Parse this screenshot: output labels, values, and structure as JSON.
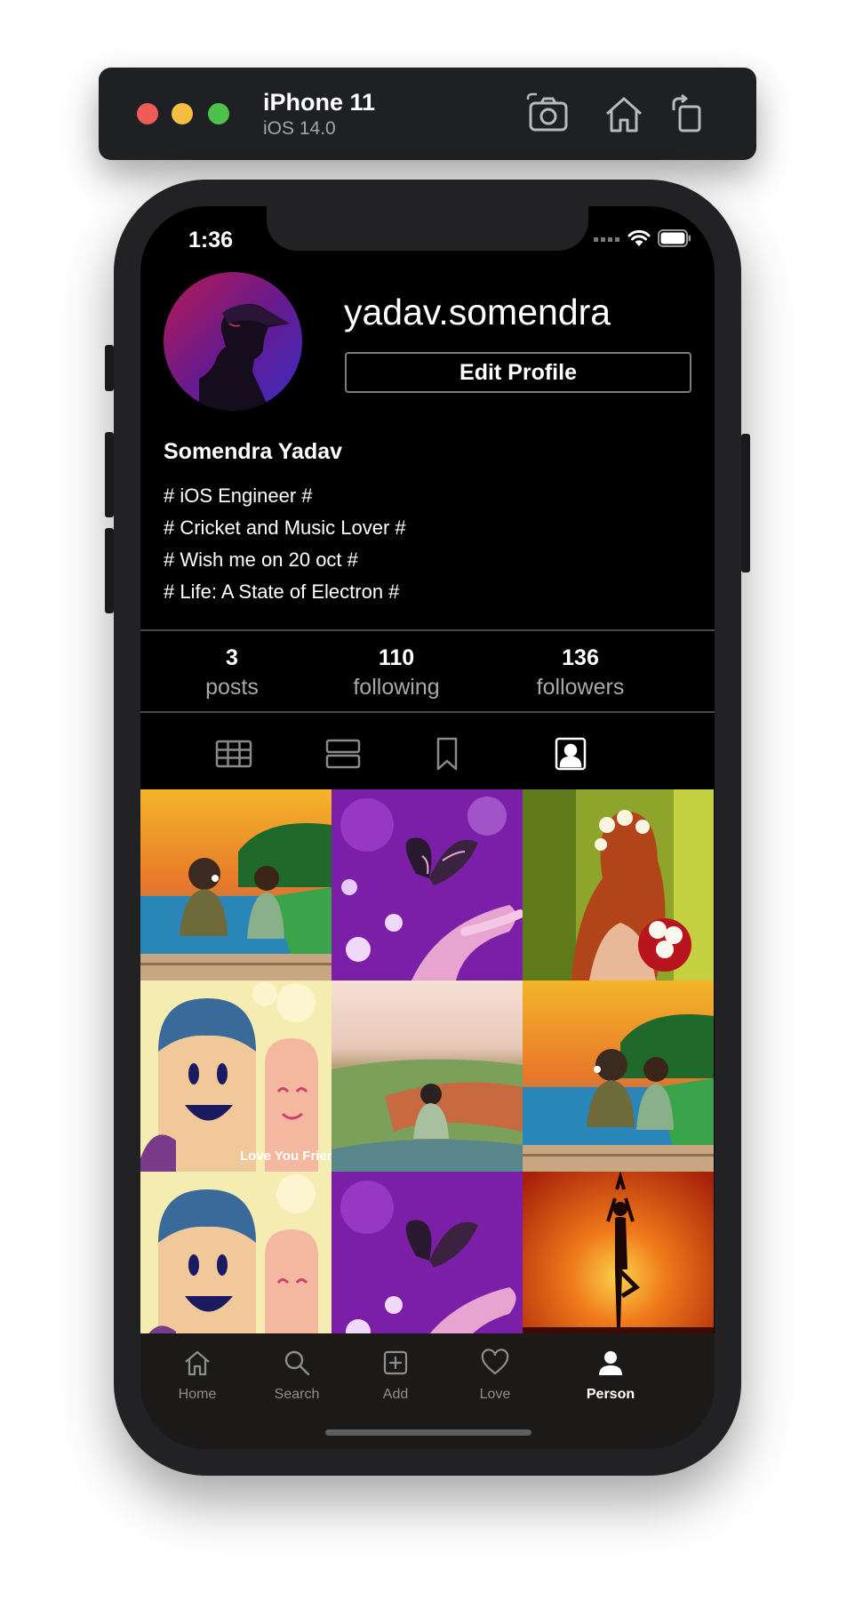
{
  "simulator": {
    "device": "iPhone 11",
    "os": "iOS 14.0",
    "buttons": [
      {
        "name": "screenshot-icon"
      },
      {
        "name": "home-icon"
      },
      {
        "name": "rotate-icon"
      }
    ]
  },
  "status_bar": {
    "time": "1:36",
    "icons": [
      "cellular-icon",
      "wifi-icon",
      "battery-icon"
    ]
  },
  "profile": {
    "username": "yadav.somendra",
    "edit_button": "Edit Profile",
    "full_name": "Somendra Yadav",
    "bio": [
      "# iOS Engineer #",
      "# Cricket and Music Lover #",
      "# Wish me on 20 oct #",
      "# Life: A State of Electron #"
    ]
  },
  "stats": {
    "posts": {
      "value": "3",
      "label": "posts"
    },
    "following": {
      "value": "110",
      "label": "following"
    },
    "followers": {
      "value": "136",
      "label": "followers"
    }
  },
  "grid_tabs": [
    {
      "name": "grid-view-icon",
      "active": false
    },
    {
      "name": "list-view-icon",
      "active": false
    },
    {
      "name": "bookmark-icon",
      "active": false
    },
    {
      "name": "tagged-icon",
      "active": true
    }
  ],
  "photos": {
    "overlay_text": "Love You Friends"
  },
  "tab_bar": {
    "items": [
      {
        "label": "Home",
        "icon": "home-icon",
        "active": false
      },
      {
        "label": "Search",
        "icon": "search-icon",
        "active": false
      },
      {
        "label": "Add",
        "icon": "add-icon",
        "active": false
      },
      {
        "label": "Love",
        "icon": "heart-icon",
        "active": false
      },
      {
        "label": "Person",
        "icon": "person-icon",
        "active": true
      }
    ]
  }
}
